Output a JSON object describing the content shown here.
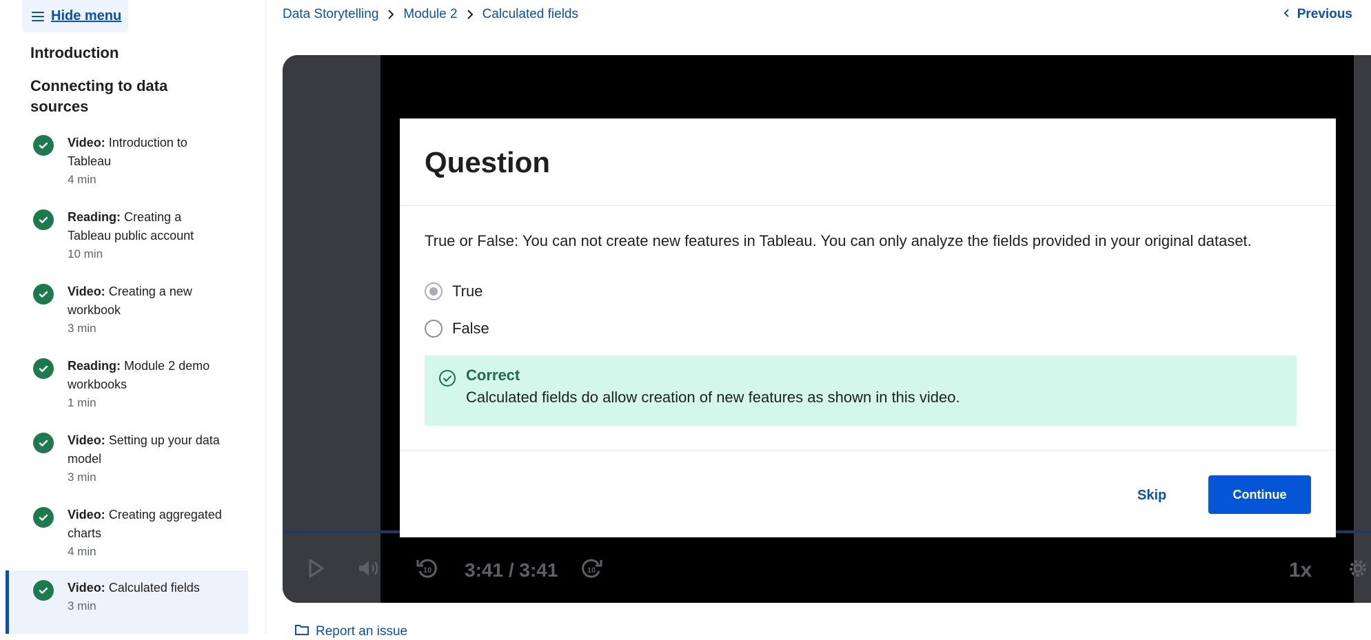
{
  "sidebar": {
    "hide_menu_label": "Hide menu",
    "sections": [
      {
        "title": "Introduction"
      },
      {
        "title": "Connecting to data sources"
      }
    ],
    "lessons": [
      {
        "type": "Video:",
        "title": "Introduction to Tableau",
        "duration": "4 min"
      },
      {
        "type": "Reading:",
        "title": "Creating a Tableau public account",
        "duration": "10 min"
      },
      {
        "type": "Video:",
        "title": "Creating a new workbook",
        "duration": "3 min"
      },
      {
        "type": "Reading:",
        "title": "Module 2 demo workbooks",
        "duration": "1 min"
      },
      {
        "type": "Video:",
        "title": "Setting up your data model",
        "duration": "3 min"
      },
      {
        "type": "Video:",
        "title": "Creating aggregated charts",
        "duration": "4 min"
      },
      {
        "type": "Video:",
        "title": "Calculated fields",
        "duration": "3 min"
      }
    ]
  },
  "breadcrumb": {
    "items": [
      "Data Storytelling",
      "Module 2",
      "Calculated fields"
    ]
  },
  "nav": {
    "previous_label": "Previous"
  },
  "player": {
    "time": "3:41 / 3:41",
    "speed": "1x",
    "rewind_seconds": "10",
    "forward_seconds": "10"
  },
  "question": {
    "heading": "Question",
    "prompt": "True or False: You can not create new features in Tableau. You can only analyze the fields provided in your original dataset.",
    "options": [
      {
        "label": "True",
        "selected": true
      },
      {
        "label": "False",
        "selected": false
      }
    ],
    "feedback": {
      "status": "Correct",
      "message": "Calculated fields do allow creation of new features as shown in this video."
    },
    "skip_label": "Skip",
    "continue_label": "Continue"
  },
  "footer": {
    "report_label": "Report an issue"
  },
  "colors": {
    "accent": "#0b4fb3",
    "button": "#0456d6",
    "success": "#1d7a4f",
    "feedback_bg": "#d4f7ec"
  }
}
